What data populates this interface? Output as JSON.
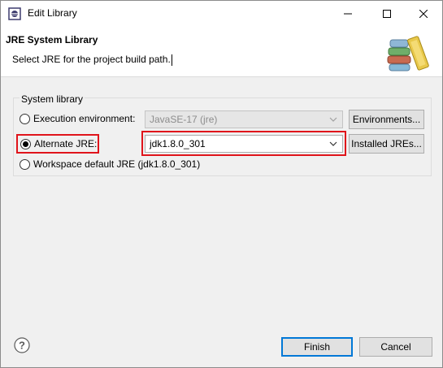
{
  "window": {
    "title": "Edit Library",
    "controls": {
      "minimize": "minimize",
      "maximize": "maximize",
      "close": "close"
    }
  },
  "header": {
    "title": "JRE System Library",
    "description": "Select JRE for the project build path."
  },
  "group": {
    "label": "System library",
    "options": {
      "execution_environment": {
        "label": "Execution environment:",
        "value": "JavaSE-17 (jre)",
        "button": "Environments...",
        "selected": false,
        "enabled": false
      },
      "alternate_jre": {
        "label": "Alternate JRE:",
        "value": "jdk1.8.0_301",
        "button": "Installed JREs...",
        "selected": true,
        "enabled": true
      },
      "workspace_default": {
        "label": "Workspace default JRE (jdk1.8.0_301)",
        "selected": false
      }
    }
  },
  "footer": {
    "finish": "Finish",
    "cancel": "Cancel"
  },
  "colors": {
    "highlight": "#e0141b",
    "accent": "#0078d7"
  }
}
